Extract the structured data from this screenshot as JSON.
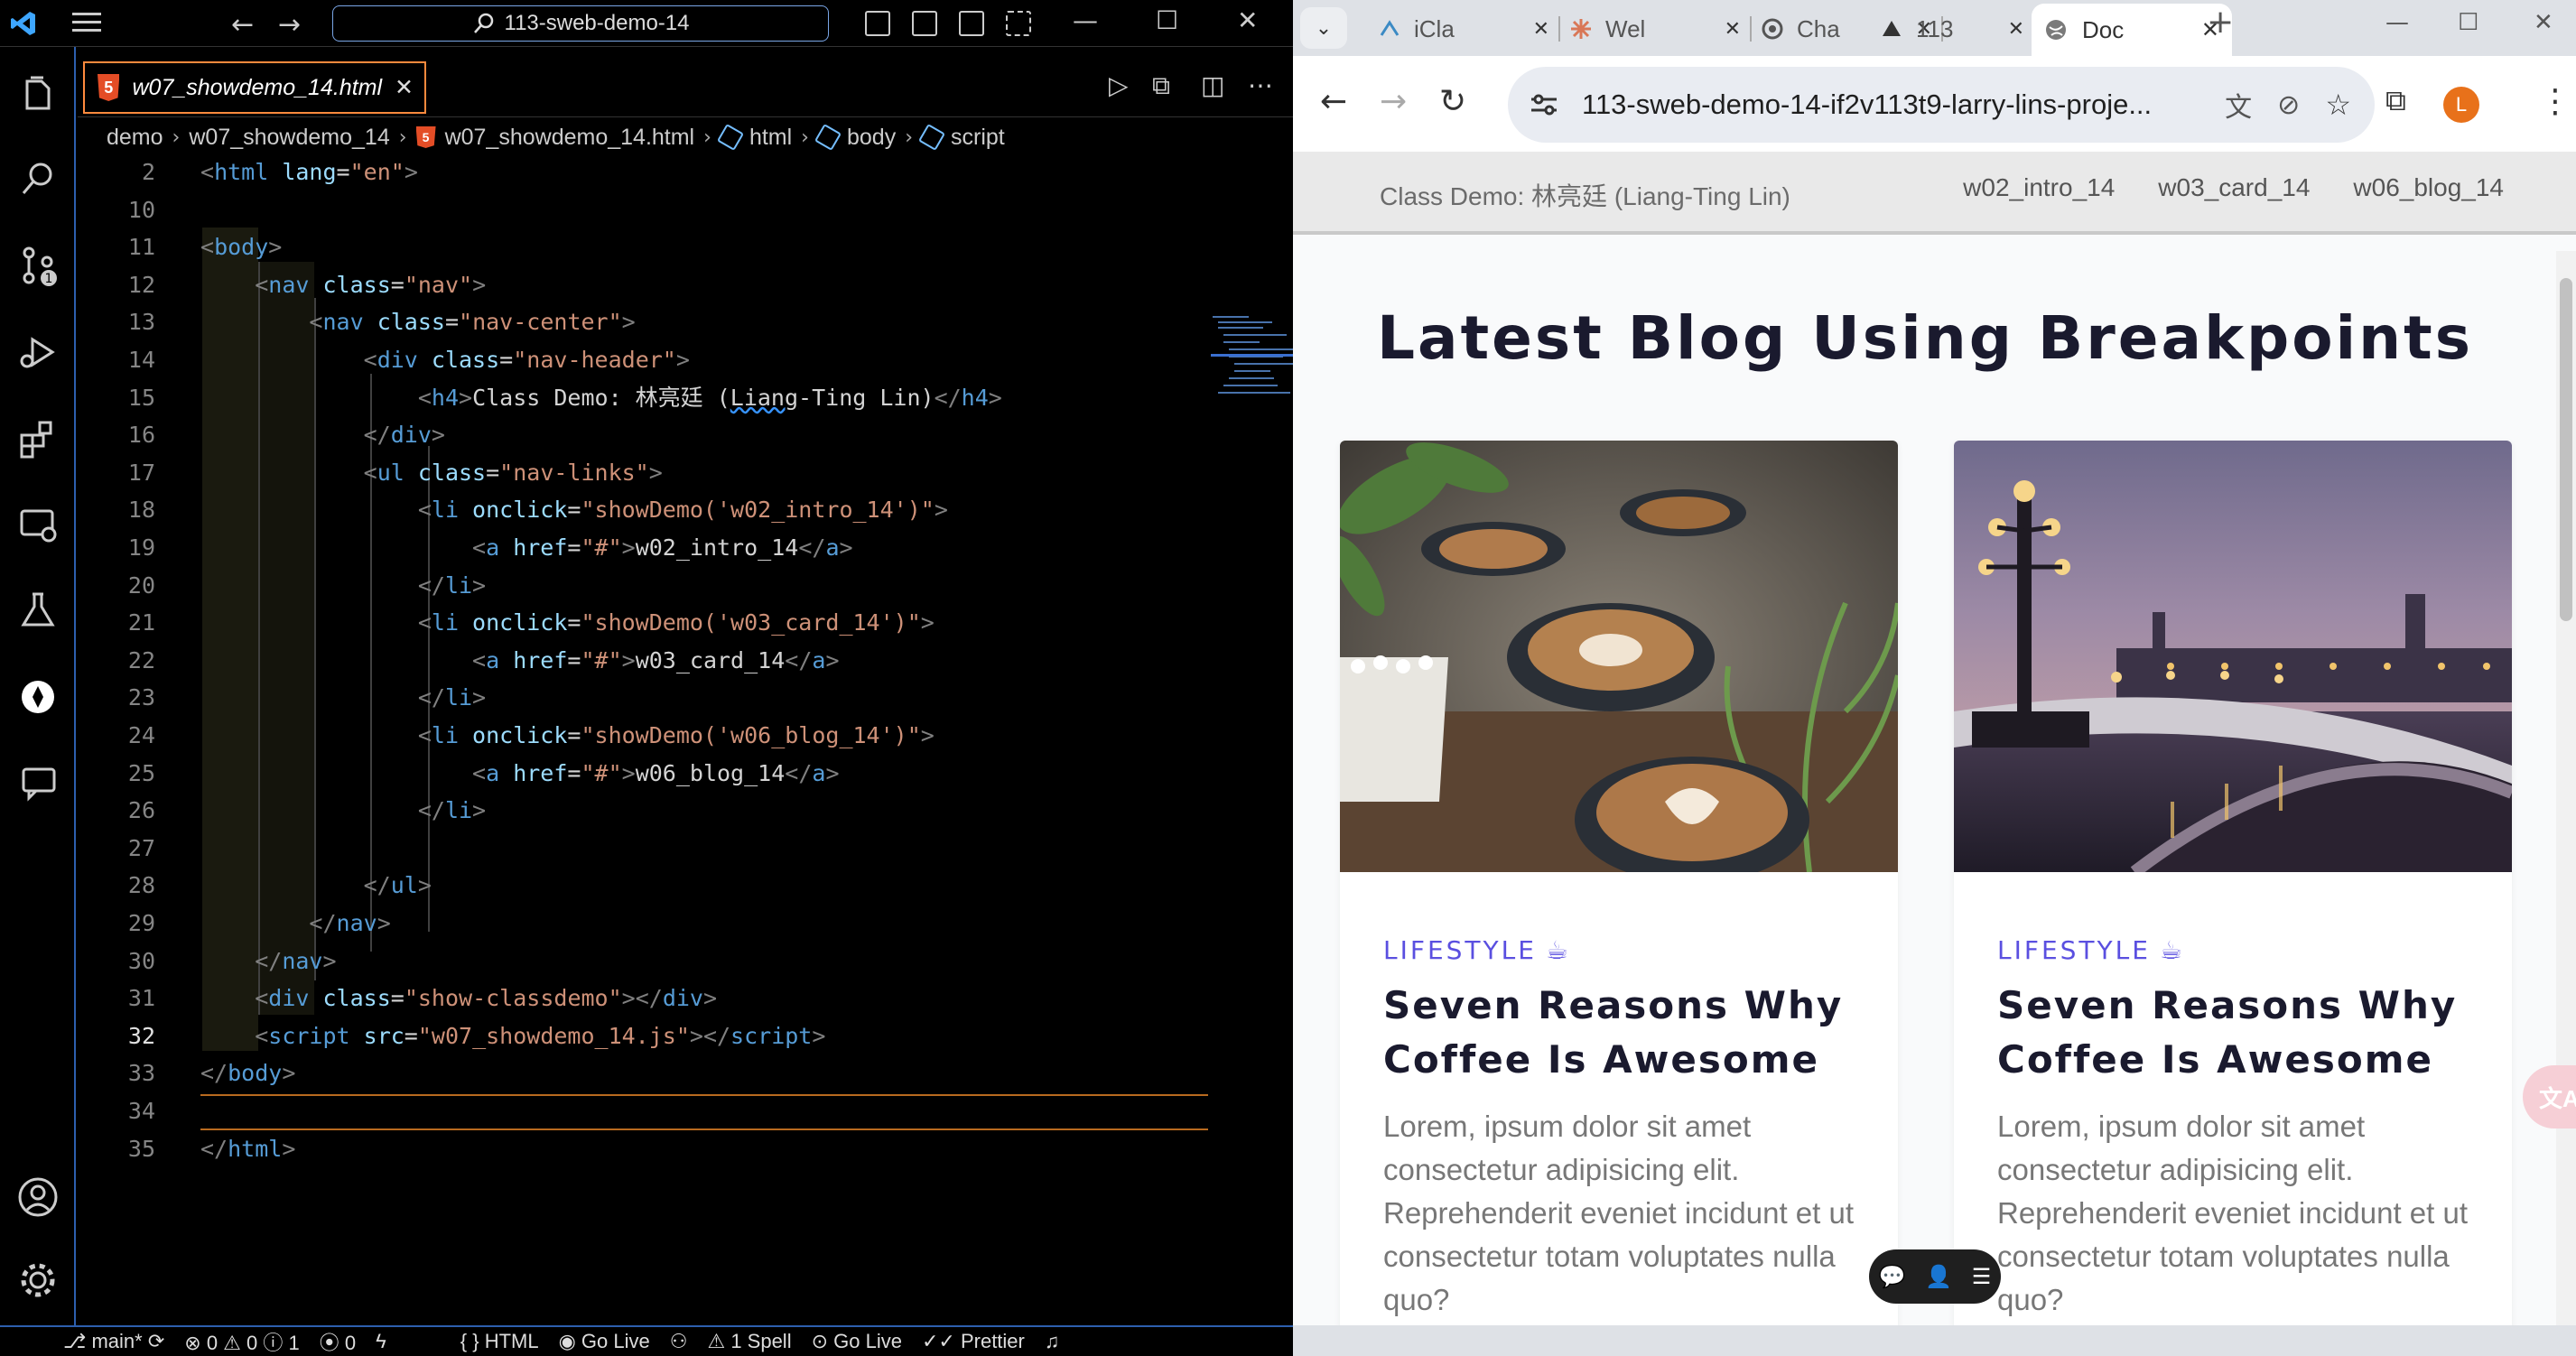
{
  "vscode": {
    "command_center": "113-sweb-demo-14",
    "active_tab": "w07_showdemo_14.html",
    "html5_glyph": "5",
    "breadcrumb": [
      "demo",
      "w07_showdemo_14",
      "w07_showdemo_14.html",
      "html",
      "body",
      "script"
    ],
    "lines": [
      {
        "n": "2",
        "code": [
          [
            "t",
            "<"
          ],
          [
            "tg",
            "html "
          ],
          [
            "at",
            "lang"
          ],
          [
            "tx",
            "="
          ],
          [
            "vl",
            "\"en\""
          ],
          [
            "t",
            ">"
          ]
        ]
      },
      {
        "n": "10",
        "code": []
      },
      {
        "n": "11",
        "code": [
          [
            "t",
            "<"
          ],
          [
            "tg",
            "body"
          ],
          [
            "t",
            ">"
          ]
        ]
      },
      {
        "n": "12",
        "code": [
          [
            "tx",
            "    "
          ],
          [
            "t",
            "<"
          ],
          [
            "tg",
            "nav "
          ],
          [
            "at",
            "class"
          ],
          [
            "tx",
            "="
          ],
          [
            "vl",
            "\"nav\""
          ],
          [
            "t",
            ">"
          ]
        ]
      },
      {
        "n": "13",
        "code": [
          [
            "tx",
            "        "
          ],
          [
            "t",
            "<"
          ],
          [
            "tg",
            "nav "
          ],
          [
            "at",
            "class"
          ],
          [
            "tx",
            "="
          ],
          [
            "vl",
            "\"nav-center\""
          ],
          [
            "t",
            ">"
          ]
        ]
      },
      {
        "n": "14",
        "code": [
          [
            "tx",
            "            "
          ],
          [
            "t",
            "<"
          ],
          [
            "tg",
            "div "
          ],
          [
            "at",
            "class"
          ],
          [
            "tx",
            "="
          ],
          [
            "vl",
            "\"nav-header\""
          ],
          [
            "t",
            ">"
          ]
        ]
      },
      {
        "n": "15",
        "code": [
          [
            "tx",
            "                "
          ],
          [
            "t",
            "<"
          ],
          [
            "tg",
            "h4"
          ],
          [
            "t",
            ">"
          ],
          [
            "tx",
            "Class Demo: 林亮廷 ("
          ],
          [
            "sq",
            "Liang"
          ],
          [
            "tx",
            "-Ting Lin)"
          ],
          [
            "t",
            "</"
          ],
          [
            "tg",
            "h4"
          ],
          [
            "t",
            ">"
          ]
        ]
      },
      {
        "n": "16",
        "code": [
          [
            "tx",
            "            "
          ],
          [
            "t",
            "</"
          ],
          [
            "tg",
            "div"
          ],
          [
            "t",
            ">"
          ]
        ]
      },
      {
        "n": "17",
        "code": [
          [
            "tx",
            "            "
          ],
          [
            "t",
            "<"
          ],
          [
            "tg",
            "ul "
          ],
          [
            "at",
            "class"
          ],
          [
            "tx",
            "="
          ],
          [
            "vl",
            "\"nav-links\""
          ],
          [
            "t",
            ">"
          ]
        ]
      },
      {
        "n": "18",
        "code": [
          [
            "tx",
            "                "
          ],
          [
            "t",
            "<"
          ],
          [
            "tg",
            "li "
          ],
          [
            "at",
            "onclick"
          ],
          [
            "tx",
            "="
          ],
          [
            "vl",
            "\"showDemo("
          ],
          [
            "vl",
            "'w02_intro_14'"
          ],
          [
            "vl",
            ")\""
          ],
          [
            "t",
            ">"
          ]
        ]
      },
      {
        "n": "19",
        "code": [
          [
            "tx",
            "                    "
          ],
          [
            "t",
            "<"
          ],
          [
            "tg",
            "a "
          ],
          [
            "at",
            "href"
          ],
          [
            "tx",
            "="
          ],
          [
            "vl",
            "\"#\""
          ],
          [
            "t",
            ">"
          ],
          [
            "tx",
            "w02_intro_14"
          ],
          [
            "t",
            "</"
          ],
          [
            "tg",
            "a"
          ],
          [
            "t",
            ">"
          ]
        ]
      },
      {
        "n": "20",
        "code": [
          [
            "tx",
            "                "
          ],
          [
            "t",
            "</"
          ],
          [
            "tg",
            "li"
          ],
          [
            "t",
            ">"
          ]
        ]
      },
      {
        "n": "21",
        "code": [
          [
            "tx",
            "                "
          ],
          [
            "t",
            "<"
          ],
          [
            "tg",
            "li "
          ],
          [
            "at",
            "onclick"
          ],
          [
            "tx",
            "="
          ],
          [
            "vl",
            "\"showDemo("
          ],
          [
            "vl",
            "'w03_card_14'"
          ],
          [
            "vl",
            ")\""
          ],
          [
            "t",
            ">"
          ]
        ]
      },
      {
        "n": "22",
        "code": [
          [
            "tx",
            "                    "
          ],
          [
            "t",
            "<"
          ],
          [
            "tg",
            "a "
          ],
          [
            "at",
            "href"
          ],
          [
            "tx",
            "="
          ],
          [
            "vl",
            "\"#\""
          ],
          [
            "t",
            ">"
          ],
          [
            "tx",
            "w03_card_14"
          ],
          [
            "t",
            "</"
          ],
          [
            "tg",
            "a"
          ],
          [
            "t",
            ">"
          ]
        ]
      },
      {
        "n": "23",
        "code": [
          [
            "tx",
            "                "
          ],
          [
            "t",
            "</"
          ],
          [
            "tg",
            "li"
          ],
          [
            "t",
            ">"
          ]
        ]
      },
      {
        "n": "24",
        "code": [
          [
            "tx",
            "                "
          ],
          [
            "t",
            "<"
          ],
          [
            "tg",
            "li "
          ],
          [
            "at",
            "onclick"
          ],
          [
            "tx",
            "="
          ],
          [
            "vl",
            "\"showDemo("
          ],
          [
            "vl",
            "'w06_blog_14'"
          ],
          [
            "vl",
            ")\""
          ],
          [
            "t",
            ">"
          ]
        ]
      },
      {
        "n": "25",
        "code": [
          [
            "tx",
            "                    "
          ],
          [
            "t",
            "<"
          ],
          [
            "tg",
            "a "
          ],
          [
            "at",
            "href"
          ],
          [
            "tx",
            "="
          ],
          [
            "vl",
            "\"#\""
          ],
          [
            "t",
            ">"
          ],
          [
            "tx",
            "w06_blog_14"
          ],
          [
            "t",
            "</"
          ],
          [
            "tg",
            "a"
          ],
          [
            "t",
            ">"
          ]
        ]
      },
      {
        "n": "26",
        "code": [
          [
            "tx",
            "                "
          ],
          [
            "t",
            "</"
          ],
          [
            "tg",
            "li"
          ],
          [
            "t",
            ">"
          ]
        ]
      },
      {
        "n": "27",
        "code": []
      },
      {
        "n": "28",
        "code": [
          [
            "tx",
            "            "
          ],
          [
            "t",
            "</"
          ],
          [
            "tg",
            "ul"
          ],
          [
            "t",
            ">"
          ]
        ]
      },
      {
        "n": "29",
        "code": [
          [
            "tx",
            "        "
          ],
          [
            "t",
            "</"
          ],
          [
            "tg",
            "nav"
          ],
          [
            "t",
            ">"
          ]
        ]
      },
      {
        "n": "30",
        "code": [
          [
            "tx",
            "    "
          ],
          [
            "t",
            "</"
          ],
          [
            "tg",
            "nav"
          ],
          [
            "t",
            ">"
          ]
        ]
      },
      {
        "n": "31",
        "code": [
          [
            "tx",
            "    "
          ],
          [
            "t",
            "<"
          ],
          [
            "tg",
            "div "
          ],
          [
            "at",
            "class"
          ],
          [
            "tx",
            "="
          ],
          [
            "vl",
            "\"show-classdemo\""
          ],
          [
            "t",
            "></"
          ],
          [
            "tg",
            "div"
          ],
          [
            "t",
            ">"
          ]
        ]
      },
      {
        "n": "32",
        "code": [
          [
            "tx",
            "    "
          ],
          [
            "t",
            "<"
          ],
          [
            "tg",
            "script "
          ],
          [
            "at",
            "src"
          ],
          [
            "tx",
            "="
          ],
          [
            "vl",
            "\"w07_showdemo_14.js\""
          ],
          [
            "t",
            "></"
          ],
          [
            "tg",
            "script"
          ],
          [
            "t",
            ">"
          ]
        ],
        "current": true
      },
      {
        "n": "33",
        "code": [
          [
            "t",
            "</"
          ],
          [
            "tg",
            "body"
          ],
          [
            "t",
            ">"
          ]
        ]
      },
      {
        "n": "34",
        "code": []
      },
      {
        "n": "35",
        "code": [
          [
            "t",
            "</"
          ],
          [
            "tg",
            "html"
          ],
          [
            "t",
            ">"
          ]
        ]
      }
    ],
    "status": {
      "branch": "main*",
      "errors": "0",
      "warnings": "0",
      "info": "1",
      "ports": "0",
      "language": "HTML",
      "go_live_1": "Go Live",
      "spell": "1 Spell",
      "go_live_2": "Go Live",
      "prettier": "Prettier"
    }
  },
  "chrome": {
    "tabs": [
      {
        "label": "iCla",
        "favicon": "vscode-favicon",
        "color": "#3b8ac4"
      },
      {
        "label": "Wel",
        "favicon": "claude-favicon",
        "color": "#d97757"
      },
      {
        "label": "Cha",
        "favicon": "openai-favicon",
        "color": "#555555"
      },
      {
        "label": "113",
        "favicon": "drive-favicon",
        "color": "#333333"
      }
    ],
    "active_tab": {
      "label": "Doc"
    },
    "url": "113-sweb-demo-14-if2v113t9-larry-lins-proje...",
    "avatar_letter": "L",
    "page": {
      "nav_title": "Class Demo: 林亮廷 (Liang-Ting Lin)",
      "nav_links": [
        "w02_intro_14",
        "w03_card_14",
        "w06_blog_14"
      ],
      "heading": "Latest Blog Using Breakpoints",
      "cards": [
        {
          "category": "LIFESTYLE",
          "title": "Seven Reasons Why Coffee Is Awesome",
          "body": "Lorem, ipsum dolor sit amet consectetur adipisicing elit. Reprehenderit eveniet incidunt et ut consectetur totam voluptates nulla quo?"
        },
        {
          "category": "LIFESTYLE",
          "title": "Seven Reasons Why Coffee Is Awesome",
          "body": "Lorem, ipsum dolor sit amet consectetur adipisicing elit. Reprehenderit eveniet incidunt et ut consectetur totam voluptates nulla quo?"
        }
      ]
    }
  },
  "colors": {
    "accent_orange": "#ff8a3d",
    "accent_blue": "#2d5fae",
    "category_purple": "#5a4fe0"
  }
}
